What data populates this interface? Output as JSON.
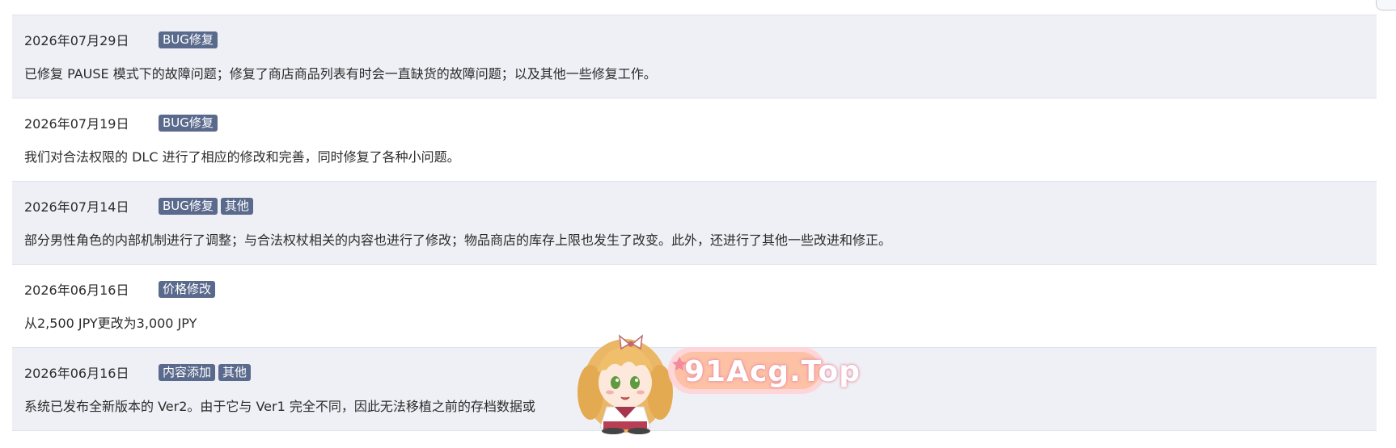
{
  "changelog": {
    "entries": [
      {
        "date": "2026年07月29日",
        "tags": [
          "BUG修复"
        ],
        "text": "已修复 PAUSE 模式下的故障问题；修复了商店商品列表有时会一直缺货的故障问题；以及其他一些修复工作。"
      },
      {
        "date": "2026年07月19日",
        "tags": [
          "BUG修复"
        ],
        "text": "我们对合法权限的 DLC 进行了相应的修改和完善，同时修复了各种小问题。"
      },
      {
        "date": "2026年07月14日",
        "tags": [
          "BUG修复",
          "其他"
        ],
        "text": "部分男性角色的内部机制进行了调整；与合法权杖相关的内容也进行了修改；物品商店的库存上限也发生了改变。此外，还进行了其他一些改进和修正。"
      },
      {
        "date": "2026年06月16日",
        "tags": [
          "价格修改"
        ],
        "text": "从2,500 JPY更改为3,000 JPY"
      },
      {
        "date": "2026年06月16日",
        "tags": [
          "内容添加",
          "其他"
        ],
        "text": "系统已发布全新版本的 Ver2。由于它与 Ver1 完全不同，因此无法移植之前的存档数据或"
      }
    ]
  },
  "watermark": {
    "text": "91Acg.Top",
    "icon": "anime-mascot-icon"
  },
  "colors": {
    "tag_bg": "#5a6a8c",
    "row_alt_bg": "#eff0f5",
    "text": "#2b2b2b",
    "divider": "#dfe2ea"
  }
}
